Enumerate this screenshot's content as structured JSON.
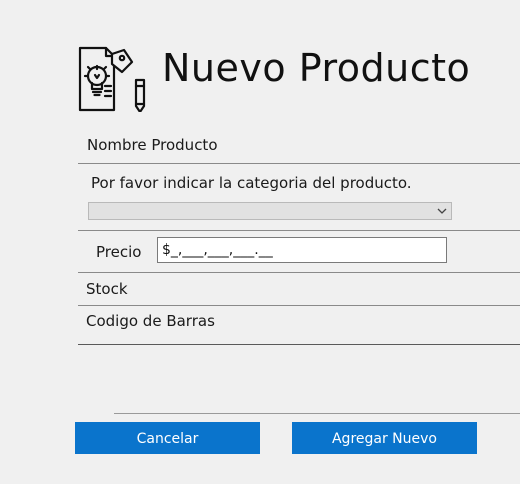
{
  "header": {
    "title": "Nuevo Producto",
    "logo_icon": "product-idea-document-icon"
  },
  "form": {
    "name_label": "Nombre Producto",
    "category_prompt": "Por favor indicar la categoria del producto.",
    "category_selected": "",
    "price_label": "Precio",
    "price_value": "$_,___,___,___.__",
    "stock_label": "Stock",
    "barcode_label": "Codigo de Barras"
  },
  "actions": {
    "cancel_label": "Cancelar",
    "add_label": "Agregar Nuevo"
  },
  "colors": {
    "button": "#0a74cc",
    "button_text": "#ffffff",
    "background": "#f0f0f0"
  }
}
